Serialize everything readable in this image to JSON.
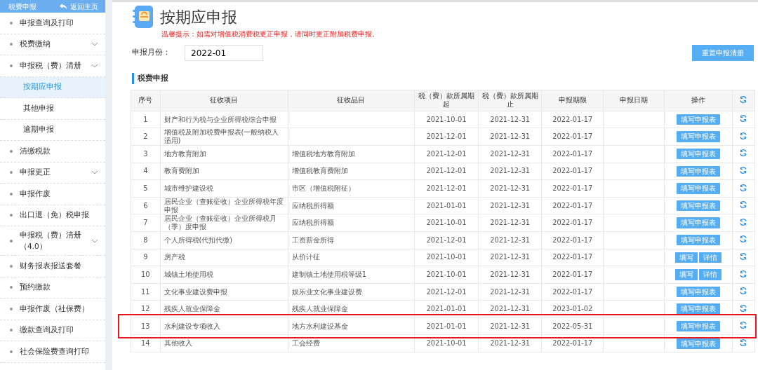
{
  "sidebar": {
    "title": "税费申报",
    "back_link": "返回主页",
    "items": [
      {
        "label": "申报查询及打印",
        "kind": "item",
        "has_submenu": false,
        "selected": false
      },
      {
        "label": "税费缴纳",
        "kind": "item",
        "has_submenu": true,
        "selected": false
      },
      {
        "label": "申报税（费）清册",
        "kind": "item",
        "has_submenu": true,
        "selected": false
      },
      {
        "label": "按期应申报",
        "kind": "sub",
        "has_submenu": false,
        "selected": true
      },
      {
        "label": "其他申报",
        "kind": "sub",
        "has_submenu": false,
        "selected": false
      },
      {
        "label": "逾期申报",
        "kind": "sub",
        "has_submenu": false,
        "selected": false
      },
      {
        "label": "清缴税款",
        "kind": "item",
        "has_submenu": false,
        "selected": false
      },
      {
        "label": "申报更正",
        "kind": "item",
        "has_submenu": true,
        "selected": false
      },
      {
        "label": "申报作废",
        "kind": "item",
        "has_submenu": false,
        "selected": false
      },
      {
        "label": "出口退（免）税申报",
        "kind": "item",
        "has_submenu": false,
        "selected": false
      },
      {
        "label": "申报税（费）清册（4.0）",
        "kind": "item",
        "has_submenu": true,
        "selected": false
      },
      {
        "label": "财务报表报送套餐",
        "kind": "item",
        "has_submenu": false,
        "selected": false
      },
      {
        "label": "预约缴款",
        "kind": "item",
        "has_submenu": false,
        "selected": false
      },
      {
        "label": "申报作废（社保费）",
        "kind": "item",
        "has_submenu": false,
        "selected": false
      },
      {
        "label": "缴款查询及打印",
        "kind": "item",
        "has_submenu": false,
        "selected": false
      },
      {
        "label": "社会保险费查询打印",
        "kind": "item",
        "has_submenu": false,
        "selected": false
      }
    ]
  },
  "page": {
    "title": "按期应申报",
    "notice": "温馨提示：如需对增值税消费税更正申报，请同时更正附加税费申报。",
    "month_label": "申报月份：",
    "month_value": "2022-01",
    "reset_button": "重置申报清册",
    "section_title": "税费申报"
  },
  "table": {
    "columns": [
      "序号",
      "征收项目",
      "征收品目",
      "税（费）款所属期起",
      "税（费）款所属期止",
      "申报期限",
      "申报日期",
      "操作"
    ],
    "rows": [
      {
        "no": "1",
        "item": "财产和行为税与企业所得税综合申报",
        "start": "2021-10-01",
        "end": "2021-12-31",
        "deadline": "2022-01-17",
        "actions": [
          "填写申报表"
        ],
        "highlighted": false
      },
      {
        "no": "2",
        "item": "增值税及附加税费申报表(一般纳税人适用)",
        "start": "2021-12-01",
        "end": "2021-12-31",
        "deadline": "2022-01-17",
        "actions": [
          "填写申报表"
        ],
        "highlighted": false
      },
      {
        "no": "3",
        "item": "地方教育附加",
        "category": "增值税地方教育附加",
        "start": "2021-12-01",
        "end": "2021-12-31",
        "deadline": "2022-01-17",
        "actions": [
          "填写申报表"
        ],
        "highlighted": false
      },
      {
        "no": "4",
        "item": "教育费附加",
        "category": "增值税教育费附加",
        "start": "2021-12-01",
        "end": "2021-12-31",
        "deadline": "2022-01-17",
        "actions": [
          "填写申报表"
        ],
        "highlighted": false
      },
      {
        "no": "5",
        "item": "城市维护建设税",
        "category": "市区（增值税附征）",
        "start": "2021-12-01",
        "end": "2021-12-31",
        "deadline": "2022-01-17",
        "actions": [
          "填写申报表"
        ],
        "highlighted": false
      },
      {
        "no": "6",
        "item": "居民企业（查账征收）企业所得税年度申报",
        "category": "应纳税所得额",
        "start": "2021-01-01",
        "end": "2021-12-31",
        "deadline": "2022-01-17",
        "actions": [
          "填写申报表"
        ],
        "highlighted": false
      },
      {
        "no": "7",
        "item": "居民企业（查账征收）企业所得税月（季）度申报",
        "category": "应纳税所得额",
        "start": "2021-10-01",
        "end": "2021-12-31",
        "deadline": "2022-01-17",
        "actions": [
          "填写申报表"
        ],
        "highlighted": false
      },
      {
        "no": "8",
        "item": "个人所得税(代扣代缴)",
        "category": "工资薪金所得",
        "start": "2021-12-01",
        "end": "2021-12-31",
        "deadline": "2022-01-17",
        "actions": [
          "填写申报表"
        ],
        "highlighted": false
      },
      {
        "no": "9",
        "item": "房产税",
        "category": "从价计征",
        "start": "2021-10-01",
        "end": "2021-12-31",
        "deadline": "2022-01-17",
        "actions": [
          "填写",
          "详情"
        ],
        "highlighted": false
      },
      {
        "no": "10",
        "item": "城镇土地使用税",
        "category": "建制镇土地使用税等级1",
        "start": "2021-10-01",
        "end": "2021-12-31",
        "deadline": "2022-01-17",
        "actions": [
          "填写",
          "详情"
        ],
        "highlighted": false
      },
      {
        "no": "11",
        "item": "文化事业建设费申报",
        "category": "娱乐业文化事业建设费",
        "start": "2021-12-01",
        "end": "2021-12-31",
        "deadline": "2022-01-17",
        "actions": [
          "填写申报表"
        ],
        "highlighted": false
      },
      {
        "no": "12",
        "item": "残疾人就业保障金",
        "category": "残疾人就业保障金",
        "start": "2021-01-01",
        "end": "2021-12-31",
        "deadline": "2023-01-02",
        "actions": [
          "填写申报表"
        ],
        "highlighted": false
      },
      {
        "no": "13",
        "item": "水利建设专项收入",
        "category": "地方水利建设基金",
        "start": "2021-01-01",
        "end": "2021-12-31",
        "deadline": "2022-05-31",
        "actions": [
          "填写申报表"
        ],
        "highlighted": true
      },
      {
        "no": "14",
        "item": "其他收入",
        "category": "工会经费",
        "start": "2021-10-01",
        "end": "2021-12-31",
        "deadline": "2022-01-17",
        "actions": [
          "填写申报表"
        ],
        "highlighted": false
      }
    ]
  }
}
